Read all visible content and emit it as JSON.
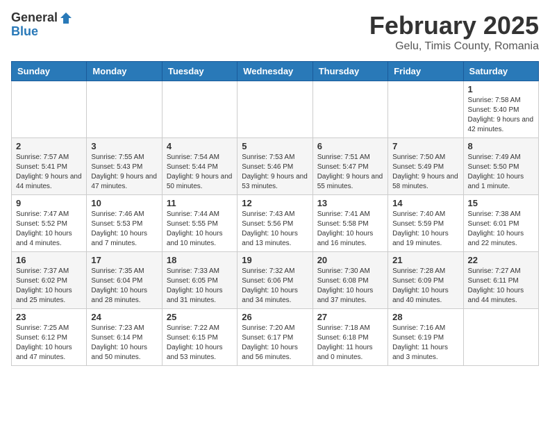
{
  "logo": {
    "general": "General",
    "blue": "Blue"
  },
  "title": "February 2025",
  "location": "Gelu, Timis County, Romania",
  "days_of_week": [
    "Sunday",
    "Monday",
    "Tuesday",
    "Wednesday",
    "Thursday",
    "Friday",
    "Saturday"
  ],
  "weeks": [
    [
      {
        "day": "",
        "info": ""
      },
      {
        "day": "",
        "info": ""
      },
      {
        "day": "",
        "info": ""
      },
      {
        "day": "",
        "info": ""
      },
      {
        "day": "",
        "info": ""
      },
      {
        "day": "",
        "info": ""
      },
      {
        "day": "1",
        "info": "Sunrise: 7:58 AM\nSunset: 5:40 PM\nDaylight: 9 hours and 42 minutes."
      }
    ],
    [
      {
        "day": "2",
        "info": "Sunrise: 7:57 AM\nSunset: 5:41 PM\nDaylight: 9 hours and 44 minutes."
      },
      {
        "day": "3",
        "info": "Sunrise: 7:55 AM\nSunset: 5:43 PM\nDaylight: 9 hours and 47 minutes."
      },
      {
        "day": "4",
        "info": "Sunrise: 7:54 AM\nSunset: 5:44 PM\nDaylight: 9 hours and 50 minutes."
      },
      {
        "day": "5",
        "info": "Sunrise: 7:53 AM\nSunset: 5:46 PM\nDaylight: 9 hours and 53 minutes."
      },
      {
        "day": "6",
        "info": "Sunrise: 7:51 AM\nSunset: 5:47 PM\nDaylight: 9 hours and 55 minutes."
      },
      {
        "day": "7",
        "info": "Sunrise: 7:50 AM\nSunset: 5:49 PM\nDaylight: 9 hours and 58 minutes."
      },
      {
        "day": "8",
        "info": "Sunrise: 7:49 AM\nSunset: 5:50 PM\nDaylight: 10 hours and 1 minute."
      }
    ],
    [
      {
        "day": "9",
        "info": "Sunrise: 7:47 AM\nSunset: 5:52 PM\nDaylight: 10 hours and 4 minutes."
      },
      {
        "day": "10",
        "info": "Sunrise: 7:46 AM\nSunset: 5:53 PM\nDaylight: 10 hours and 7 minutes."
      },
      {
        "day": "11",
        "info": "Sunrise: 7:44 AM\nSunset: 5:55 PM\nDaylight: 10 hours and 10 minutes."
      },
      {
        "day": "12",
        "info": "Sunrise: 7:43 AM\nSunset: 5:56 PM\nDaylight: 10 hours and 13 minutes."
      },
      {
        "day": "13",
        "info": "Sunrise: 7:41 AM\nSunset: 5:58 PM\nDaylight: 10 hours and 16 minutes."
      },
      {
        "day": "14",
        "info": "Sunrise: 7:40 AM\nSunset: 5:59 PM\nDaylight: 10 hours and 19 minutes."
      },
      {
        "day": "15",
        "info": "Sunrise: 7:38 AM\nSunset: 6:01 PM\nDaylight: 10 hours and 22 minutes."
      }
    ],
    [
      {
        "day": "16",
        "info": "Sunrise: 7:37 AM\nSunset: 6:02 PM\nDaylight: 10 hours and 25 minutes."
      },
      {
        "day": "17",
        "info": "Sunrise: 7:35 AM\nSunset: 6:04 PM\nDaylight: 10 hours and 28 minutes."
      },
      {
        "day": "18",
        "info": "Sunrise: 7:33 AM\nSunset: 6:05 PM\nDaylight: 10 hours and 31 minutes."
      },
      {
        "day": "19",
        "info": "Sunrise: 7:32 AM\nSunset: 6:06 PM\nDaylight: 10 hours and 34 minutes."
      },
      {
        "day": "20",
        "info": "Sunrise: 7:30 AM\nSunset: 6:08 PM\nDaylight: 10 hours and 37 minutes."
      },
      {
        "day": "21",
        "info": "Sunrise: 7:28 AM\nSunset: 6:09 PM\nDaylight: 10 hours and 40 minutes."
      },
      {
        "day": "22",
        "info": "Sunrise: 7:27 AM\nSunset: 6:11 PM\nDaylight: 10 hours and 44 minutes."
      }
    ],
    [
      {
        "day": "23",
        "info": "Sunrise: 7:25 AM\nSunset: 6:12 PM\nDaylight: 10 hours and 47 minutes."
      },
      {
        "day": "24",
        "info": "Sunrise: 7:23 AM\nSunset: 6:14 PM\nDaylight: 10 hours and 50 minutes."
      },
      {
        "day": "25",
        "info": "Sunrise: 7:22 AM\nSunset: 6:15 PM\nDaylight: 10 hours and 53 minutes."
      },
      {
        "day": "26",
        "info": "Sunrise: 7:20 AM\nSunset: 6:17 PM\nDaylight: 10 hours and 56 minutes."
      },
      {
        "day": "27",
        "info": "Sunrise: 7:18 AM\nSunset: 6:18 PM\nDaylight: 11 hours and 0 minutes."
      },
      {
        "day": "28",
        "info": "Sunrise: 7:16 AM\nSunset: 6:19 PM\nDaylight: 11 hours and 3 minutes."
      },
      {
        "day": "",
        "info": ""
      }
    ]
  ]
}
